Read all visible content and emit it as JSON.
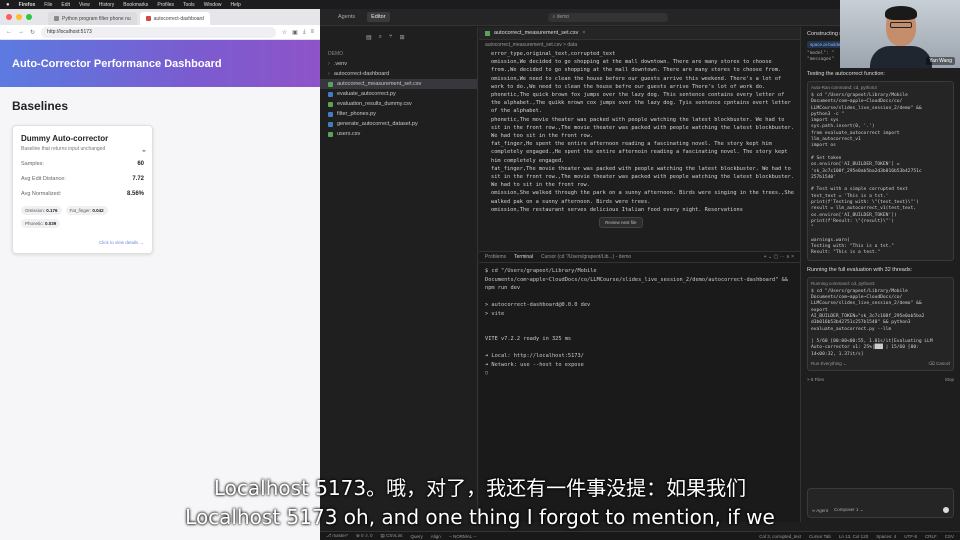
{
  "menubar": {
    "items": [
      "Firefox",
      "File",
      "Edit",
      "View",
      "History",
      "Bookmarks",
      "Profiles",
      "Tools",
      "Window",
      "Help"
    ]
  },
  "browser": {
    "tabs": [
      {
        "label": "Python program filter phone nu"
      },
      {
        "label": "autocorrect-dashboard"
      }
    ],
    "url": "http://localhost:5173"
  },
  "dashboard": {
    "title": "Auto-Corrector Performance Dashboard",
    "section_title": "Baselines",
    "card": {
      "name": "Dummy Auto-corrector",
      "description": "Baseline that returns input unchanged",
      "metrics": [
        {
          "label": "Samples:",
          "value": "60"
        },
        {
          "label": "Avg Edit Distance:",
          "value": "7.72"
        },
        {
          "label": "Avg Normalized:",
          "value": "8.56%"
        }
      ],
      "chips": [
        {
          "label": "Omission:",
          "value": "0.176"
        },
        {
          "label": "Fat_finger:",
          "value": "0.042"
        },
        {
          "label": "Phonetic:",
          "value": "0.039"
        }
      ],
      "view_details": "Click to view details →"
    }
  },
  "ide": {
    "top_tabs": [
      "Agents",
      "Editor"
    ],
    "search": "demo",
    "explorer": {
      "root": "DEMO",
      "items": [
        {
          "name": ".venv",
          "type": "folder"
        },
        {
          "name": "autocorrect-dashboard",
          "type": "folder"
        },
        {
          "name": "autocorrect_measurement_set.csv",
          "type": "csv",
          "selected": true
        },
        {
          "name": "evaluate_autocorrect.py",
          "type": "py"
        },
        {
          "name": "evaluation_results_dummy.csv",
          "type": "csv"
        },
        {
          "name": "filter_phones.py",
          "type": "py"
        },
        {
          "name": "generate_autocorrect_dataset.py",
          "type": "py"
        },
        {
          "name": "users.csv",
          "type": "csv"
        }
      ]
    },
    "editor": {
      "tab": "autocorrect_measurement_set.csv",
      "breadcrumb": "autocorrect_measurement_set.csv > data",
      "lines": [
        "error_type,original_text,corrupted_text",
        "omission,We decided to go shopping at the mall downtown. There are many stores to choose from.,We decided to go shopping at the mall downtown. There are many stores to choose from.",
        "omission,We need to clean the house before our guests arrive this weekend. There's a lot of work to do.,We need to clean the house befre our guests arrive There's lot of work do.",
        "phonetic,The quick brown fox jumps over the lazy dog. This sentence contains every letter of the alphabet.,The quikk nrown cox jumps over the lazy dog. Tyis sentence cpntains evert letter of the alphabet.",
        "phonetic,The movie theater was packed with people watching the latest blockbuster. We had to sit in the front row.,The movie theater was packed with people watching the latest blockbuster. We had too sit in the front row.",
        "fat_finger,He spent the entire afternoon reading a fascinating novel. The story kept him completely engaged.,He spent the entire afternoin reading a fascinating novel. The story kept him completely engaged.",
        "fat_finger,The movie theater was packed with people watching the latest blockbuster. We had to sit in the front row.,The movie theater was packed with people watching the latest blockbuster. We had to sit in the front row.",
        "omission,She walked through the park on a sunny afternoon. Birds were singing in the trees.,She walked pak on a sunny afternoon. Birds were trees.",
        "omission,The restaurant serves delicious Italian food every night. Reservations"
      ],
      "review_label": "Review next file"
    },
    "terminal": {
      "tabs": [
        "Problems",
        "Terminal",
        "Cursor (cd \"/Users/grapeot/Lib...) - demo"
      ],
      "lines": [
        "$ cd \"/Users/grapeot/Library/Mobile Documents/com~apple~CloudDocs/co/LLMCourse/slides_live_session_2/demo/autocorrect-dashboard\" && npm run dev",
        "",
        "> autocorrect-dashboard@0.0.0 dev",
        "> vite",
        "",
        "",
        "  VITE v7.2.2  ready in 325 ms",
        "",
        "  ➜  Local:   http://localhost:5173/",
        "  ➜  Network: use --host to expose",
        "▯"
      ]
    },
    "agent": {
      "title": "Constructing measu",
      "chip": "space.ai-builde",
      "json_lines": [
        "\"model\": \"",
        "\"messages\""
      ],
      "section1": "Testing the autocorrect function:",
      "section1_cmd": "Auto-Ran command: cd, python3",
      "code_lines": [
        "$ cd \"/Users/grapeot/Library/Mobile",
        "  Documents/com~apple~CloudDocs/co/",
        "  LLMCourse/slides_live_session_2/demo\" &&",
        "  python3 -c \"",
        "  import sys",
        "  sys.path.insert(0, '.')",
        "  from evaluate_autocorrect import",
        "  llm_autocorrect_v1",
        "  import os",
        "",
        "  # Set token",
        "  os.environ['AI_BUILDER_TOKEN'] =",
        "  'sk_3c7c108f_295e0ab5ba2d3b016b53b42751c",
        "  257b1540'",
        "",
        "  # Test with a simple corrupted text",
        "  test_text = 'This is a tst.'",
        "  print(f'Testing with: \\\"{test_text}\\\"')",
        "  result = llm_autocorrect_v1(test_text,",
        "  os.environ['AI_BUILDER_TOKEN'])",
        "  print(f'Result: \\\"{result}\\\"')",
        "  \"",
        "",
        "    warnings.warn(",
        "  Testing with: \"This is a tst.\"",
        "  Result: \"This is a test.\""
      ],
      "section2": "Running the full evaluation with 32 threads:",
      "section2_cmd": "Running command: cd, python3",
      "code2_lines": [
        "$ cd \"/Users/grapeot/Library/Mobile",
        "  Documents/com~apple~CloudDocs/co/",
        "  LLMCourse/slides_live_session_2/demo\" &&",
        "  export",
        "  AI_BUILDER_TOKEN=\"sk_3c7c108f_295e0ab5ba2",
        "  d3b016b53b42751c257b1540\" && python3",
        "  evaluate_autocorrect.py --llm",
        "",
        "  | 5/60 [00:00<00:55,  1.01s/it]Evaluating LLM",
        "  Auto-corrector v1:  25%|███     | 15/60 [00:",
        "  14<00:32,  1.37it/s]"
      ],
      "run_everything": "Run Everything ⌄",
      "skip": "Skip",
      "cancel": "⌫ Cancel",
      "run": "Run",
      "files_label": "> 8 Files",
      "stop": "Stop",
      "input_placeholder": "Plan, @ for context, / for commands",
      "agent_mode": "∞ Agent",
      "composer": "Composer 1 ⌄"
    },
    "statusbar": {
      "left": [
        "⎇ master*",
        "⊗ 0 ⚠ 0",
        "▤ CSVLint",
        "Query",
        "Align",
        "-- NORMAL --"
      ],
      "right": [
        "Col 3, corrupted_text",
        "Cursor Tab",
        "Ln 13, Col 120",
        "Spaces: 4",
        "UTF-8",
        "CRLF",
        "CSV"
      ]
    }
  },
  "webcam": {
    "name": "Yan Wang"
  },
  "subtitles": {
    "zh": "Localhost 5173。哦，对了，我还有一件事没提：如果我们",
    "en": "Localhost 5173 oh, and one thing I forgot to mention, if we"
  }
}
